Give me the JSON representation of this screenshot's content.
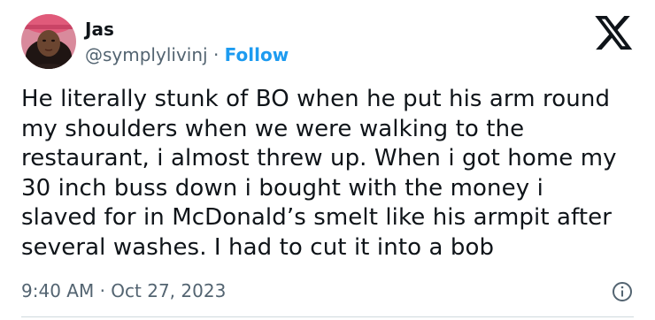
{
  "author": {
    "name": "Jas",
    "handle": "@symplylivinj",
    "separator": "·",
    "follow_label": "Follow",
    "avatar_icon": "avatar-photo"
  },
  "brand": {
    "logo_icon": "x-logo-icon"
  },
  "tweet": {
    "text": "He literally stunk of BO when he put his arm round\nmy shoulders when we were walking to the\nrestaurant, i almost threw up. When i got home my\n30 inch buss down i bought with the money i\nslaved for in McDonald’s smelt like his armpit after\nseveral washes. I had to cut it into a bob"
  },
  "meta": {
    "time": "9:40 AM",
    "separator": "·",
    "date": "Oct 27, 2023",
    "info_icon": "info-icon"
  },
  "colors": {
    "text": "#0f1419",
    "secondary": "#536471",
    "accent": "#1d9bf0"
  }
}
